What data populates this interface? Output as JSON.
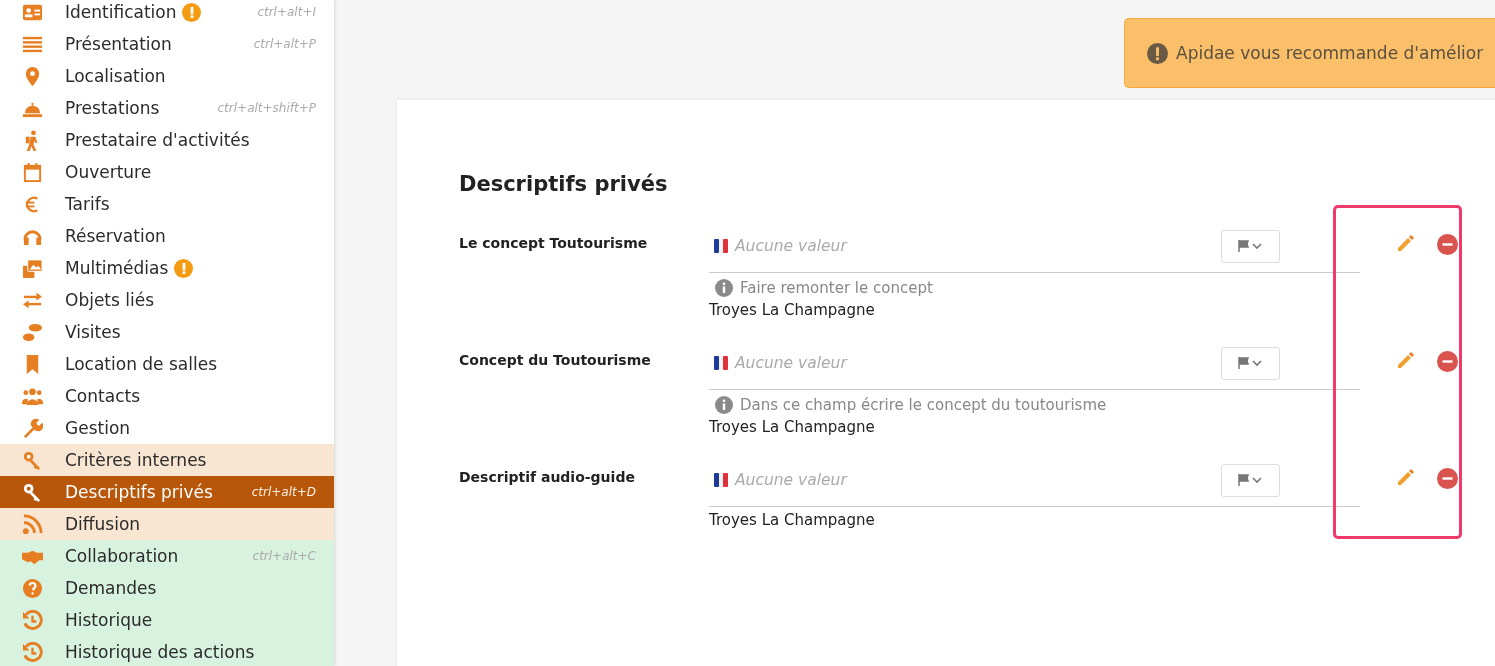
{
  "sidebar": {
    "items": [
      {
        "label": "Identification",
        "warning": true,
        "shortcut": "ctrl+alt+I",
        "kind": "main",
        "selected": false
      },
      {
        "label": "Présentation",
        "warning": false,
        "shortcut": "ctrl+alt+P",
        "kind": "main",
        "selected": false
      },
      {
        "label": "Localisation",
        "warning": false,
        "kind": "main",
        "selected": false
      },
      {
        "label": "Prestations",
        "warning": false,
        "shortcut": "ctrl+alt+shift+P",
        "kind": "main",
        "selected": false
      },
      {
        "label": "Prestataire d'activités",
        "warning": false,
        "kind": "main",
        "selected": false
      },
      {
        "label": "Ouverture",
        "warning": false,
        "kind": "main",
        "selected": false
      },
      {
        "label": "Tarifs",
        "warning": false,
        "kind": "main",
        "selected": false
      },
      {
        "label": "Réservation",
        "warning": false,
        "kind": "main",
        "selected": false
      },
      {
        "label": "Multimédias",
        "warning": true,
        "kind": "main",
        "selected": false
      },
      {
        "label": "Objets liés",
        "warning": false,
        "kind": "main",
        "selected": false
      },
      {
        "label": "Visites",
        "warning": false,
        "kind": "main",
        "selected": false
      },
      {
        "label": "Location de salles",
        "warning": false,
        "kind": "main",
        "selected": false
      },
      {
        "label": "Contacts",
        "warning": false,
        "kind": "main",
        "selected": false
      },
      {
        "label": "Gestion",
        "warning": false,
        "kind": "main",
        "selected": false
      },
      {
        "label": "Critères internes",
        "warning": false,
        "kind": "internal",
        "selected": false
      },
      {
        "label": "Descriptifs privés",
        "warning": false,
        "shortcut": "ctrl+alt+D",
        "kind": "internal",
        "selected": true
      },
      {
        "label": "Diffusion",
        "warning": false,
        "kind": "internal",
        "selected": false
      },
      {
        "label": "Collaboration",
        "warning": false,
        "shortcut": "ctrl+alt+C",
        "kind": "collab",
        "selected": false
      },
      {
        "label": "Demandes",
        "warning": false,
        "kind": "collab",
        "selected": false
      },
      {
        "label": "Historique",
        "warning": false,
        "kind": "collab",
        "selected": false
      },
      {
        "label": "Historique des actions",
        "warning": false,
        "kind": "collab",
        "selected": false
      }
    ]
  },
  "alert": {
    "text": "Apidae vous recommande d'amélior"
  },
  "card": {
    "title": "Descriptifs privés",
    "actions_highlighted": true,
    "rows": [
      {
        "label": "Le concept Toutourisme",
        "placeholder": "Aucune valeur",
        "hint": "Faire remonter le concept",
        "owner": "Troyes La Champagne"
      },
      {
        "label": "Concept du Toutourisme",
        "placeholder": "Aucune valeur",
        "hint": "Dans ce champ écrire le concept du toutourisme",
        "owner": "Troyes La Champagne"
      },
      {
        "label": "Descriptif audio-guide",
        "placeholder": "Aucune valeur",
        "owner": "Troyes La Champagne"
      }
    ]
  }
}
